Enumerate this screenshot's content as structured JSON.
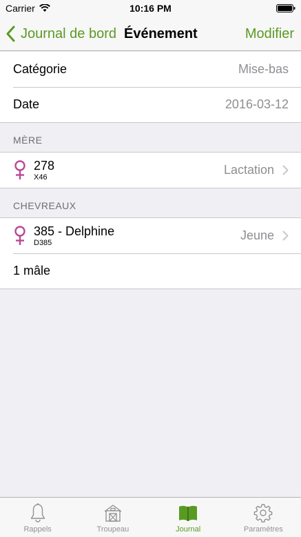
{
  "status_bar": {
    "carrier": "Carrier",
    "time": "10:16 PM"
  },
  "nav": {
    "back_label": "Journal de bord",
    "title": "Événement",
    "action_label": "Modifier"
  },
  "details": [
    {
      "label": "Catégorie",
      "value": "Mise-bas"
    },
    {
      "label": "Date",
      "value": "2016-03-12"
    }
  ],
  "mother_section": {
    "header": "MÈRE",
    "animal": {
      "name": "278",
      "code": "X46",
      "status": "Lactation"
    }
  },
  "kids_section": {
    "header": "CHEVREAUX",
    "animal": {
      "name": "385 - Delphine",
      "code": "D385",
      "status": "Jeune"
    },
    "extra": "1 mâle"
  },
  "tabs": [
    {
      "label": "Rappels",
      "icon": "bell-icon"
    },
    {
      "label": "Troupeau",
      "icon": "barn-icon"
    },
    {
      "label": "Journal",
      "icon": "book-icon",
      "active": true
    },
    {
      "label": "Paramètres",
      "icon": "gear-icon"
    }
  ],
  "colors": {
    "accent": "#5a9a22",
    "female": "#b8489a",
    "secondary_text": "#8e8e93"
  }
}
